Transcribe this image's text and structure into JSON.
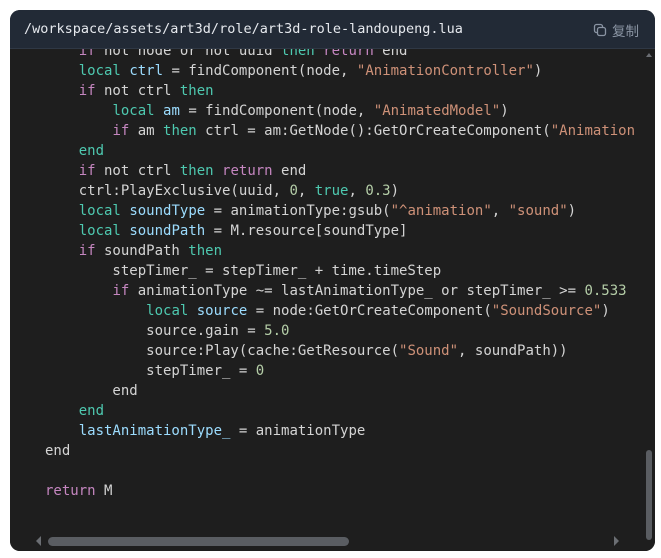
{
  "header": {
    "file_path": "/workspace/assets/art3d/role/art3d-role-landoupeng.lua",
    "copy_label": "复制",
    "copy_icon": "copy-icon"
  },
  "code_lines": [
    [
      [
        "",
        "    "
      ],
      [
        "p",
        "if"
      ],
      [
        "",
        " not node or not uuid "
      ],
      [
        "t",
        "then"
      ],
      [
        "",
        " "
      ],
      [
        "p",
        "return"
      ],
      [
        "",
        " end"
      ]
    ],
    [
      [
        "",
        "    "
      ],
      [
        "t",
        "local"
      ],
      [
        "",
        " "
      ],
      [
        "v",
        "ctrl"
      ],
      [
        "",
        " = findComponent(node, "
      ],
      [
        "s",
        "\"AnimationController\""
      ],
      [
        "",
        ")"
      ]
    ],
    [
      [
        "",
        "    "
      ],
      [
        "p",
        "if"
      ],
      [
        "",
        " not ctrl "
      ],
      [
        "t",
        "then"
      ]
    ],
    [
      [
        "",
        "        "
      ],
      [
        "t",
        "local"
      ],
      [
        "",
        " "
      ],
      [
        "v",
        "am"
      ],
      [
        "",
        " = findComponent(node, "
      ],
      [
        "s",
        "\"AnimatedModel\""
      ],
      [
        "",
        ")"
      ]
    ],
    [
      [
        "",
        "        "
      ],
      [
        "p",
        "if"
      ],
      [
        "",
        " am "
      ],
      [
        "t",
        "then"
      ],
      [
        "",
        " ctrl = am:GetNode():GetOrCreateComponent("
      ],
      [
        "s",
        "\"Animation"
      ]
    ],
    [
      [
        "",
        "    "
      ],
      [
        "t",
        "end"
      ]
    ],
    [
      [
        "",
        "    "
      ],
      [
        "p",
        "if"
      ],
      [
        "",
        " not ctrl "
      ],
      [
        "t",
        "then"
      ],
      [
        "",
        " "
      ],
      [
        "p",
        "return"
      ],
      [
        "",
        " end"
      ]
    ],
    [
      [
        "",
        "    ctrl:PlayExclusive(uuid, "
      ],
      [
        "n",
        "0"
      ],
      [
        "",
        ", "
      ],
      [
        "t",
        "true"
      ],
      [
        "",
        ", "
      ],
      [
        "n",
        "0.3"
      ],
      [
        "",
        ")"
      ]
    ],
    [
      [
        "",
        "    "
      ],
      [
        "t",
        "local"
      ],
      [
        "",
        " "
      ],
      [
        "v",
        "soundType"
      ],
      [
        "",
        " = animationType:gsub("
      ],
      [
        "s",
        "\"^animation\""
      ],
      [
        "",
        ", "
      ],
      [
        "s",
        "\"sound\""
      ],
      [
        "",
        ")"
      ]
    ],
    [
      [
        "",
        "    "
      ],
      [
        "t",
        "local"
      ],
      [
        "",
        " "
      ],
      [
        "v",
        "soundPath"
      ],
      [
        "",
        " = M.resource[soundType]"
      ]
    ],
    [
      [
        "",
        "    "
      ],
      [
        "p",
        "if"
      ],
      [
        "",
        " soundPath "
      ],
      [
        "t",
        "then"
      ]
    ],
    [
      [
        "",
        "        stepTimer_ = stepTimer_ + time.timeStep"
      ]
    ],
    [
      [
        "",
        "        "
      ],
      [
        "p",
        "if"
      ],
      [
        "",
        " animationType ~= lastAnimationType_ or stepTimer_ >= "
      ],
      [
        "n",
        "0.533"
      ]
    ],
    [
      [
        "",
        "            "
      ],
      [
        "t",
        "local"
      ],
      [
        "",
        " "
      ],
      [
        "v",
        "source"
      ],
      [
        "",
        " = node:GetOrCreateComponent("
      ],
      [
        "s",
        "\"SoundSource\""
      ],
      [
        "",
        ")"
      ]
    ],
    [
      [
        "",
        "            source.gain = "
      ],
      [
        "n",
        "5.0"
      ]
    ],
    [
      [
        "",
        "            source:Play(cache:GetResource("
      ],
      [
        "s",
        "\"Sound\""
      ],
      [
        "",
        ", soundPath))"
      ]
    ],
    [
      [
        "",
        "            stepTimer_ = "
      ],
      [
        "n",
        "0"
      ]
    ],
    [
      [
        "",
        "        end"
      ]
    ],
    [
      [
        "",
        "    "
      ],
      [
        "t",
        "end"
      ]
    ],
    [
      [
        "",
        "    "
      ],
      [
        "v",
        "lastAnimationType_"
      ],
      [
        "",
        " = animationType"
      ]
    ],
    [
      [
        "",
        "end"
      ]
    ],
    [
      [
        "",
        ""
      ]
    ],
    [
      [
        "p",
        "return"
      ],
      [
        "",
        " M"
      ]
    ]
  ]
}
